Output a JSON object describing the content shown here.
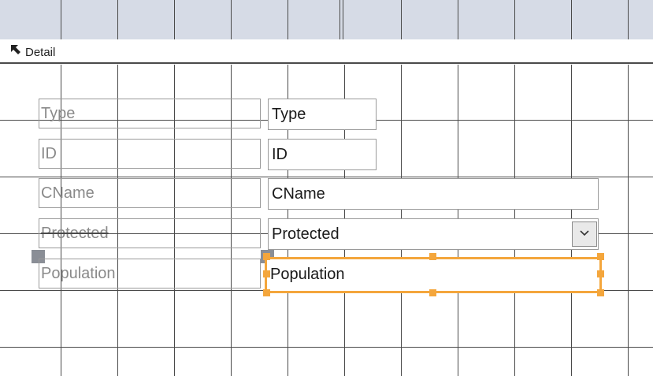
{
  "section": {
    "title": "Detail"
  },
  "controls": {
    "type": {
      "label": "Type",
      "field": "Type"
    },
    "id": {
      "label": "ID",
      "field": "ID"
    },
    "cname": {
      "label": "CName",
      "field": "CName"
    },
    "protected": {
      "label": "Protected",
      "field": "Protected"
    },
    "population": {
      "label": "Population",
      "field": "Population",
      "selected": true
    }
  },
  "icons": {
    "section_collapse": "arrow-up-left-icon",
    "combo_dropdown": "chevron-down-icon"
  },
  "colors": {
    "selection": "#f4a63c",
    "header_strip": "#d6dbe6",
    "move_handle": "#8a8e96",
    "grid_line": "#4a4a4a"
  }
}
